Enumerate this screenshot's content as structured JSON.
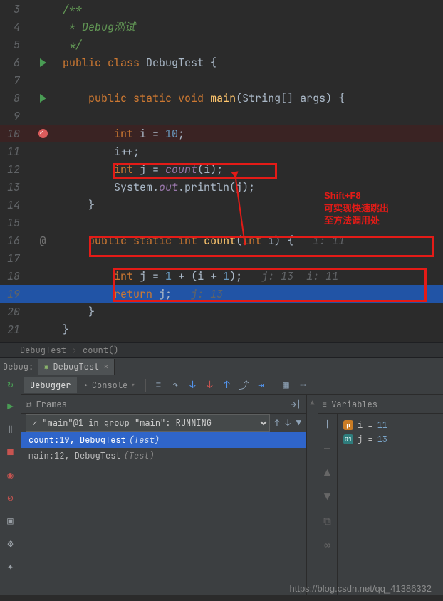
{
  "code": {
    "lines": [
      {
        "n": "3",
        "html": "/**",
        "cls": "doc"
      },
      {
        "n": "4",
        "html": " * Debug测试",
        "cls": "doc"
      },
      {
        "n": "5",
        "html": " */",
        "cls": "doc"
      },
      {
        "n": "6",
        "run": true,
        "tokens": [
          [
            "kw",
            "public "
          ],
          [
            "kw",
            "class "
          ],
          [
            "cls",
            "DebugTest "
          ],
          [
            "id",
            "{"
          ]
        ]
      },
      {
        "n": "7"
      },
      {
        "n": "8",
        "run": true,
        "indent": "    ",
        "tokens": [
          [
            "kw",
            "public "
          ],
          [
            "kw",
            "static "
          ],
          [
            "kw",
            "void "
          ],
          [
            "mth",
            "main"
          ],
          [
            "id",
            "(String[] args) {"
          ]
        ]
      },
      {
        "n": "9"
      },
      {
        "n": "10",
        "bp": true,
        "indent": "        ",
        "tokens": [
          [
            "kw",
            "int "
          ],
          [
            "id",
            "i = "
          ],
          [
            "num",
            "10"
          ],
          [
            "id",
            ";"
          ]
        ],
        "lineCls": "line-bp"
      },
      {
        "n": "11",
        "indent": "        ",
        "tokens": [
          [
            "id",
            "i++;"
          ]
        ]
      },
      {
        "n": "12",
        "indent": "        ",
        "tokens": [
          [
            "kw",
            "int "
          ],
          [
            "id",
            "j = "
          ],
          [
            "fld",
            "count"
          ],
          [
            "id",
            "(i);"
          ]
        ]
      },
      {
        "n": "13",
        "indent": "        ",
        "tokens": [
          [
            "id",
            "System."
          ],
          [
            "fld",
            "out"
          ],
          [
            "id",
            ".println(j);"
          ]
        ]
      },
      {
        "n": "14",
        "indent": "    ",
        "tokens": [
          [
            "id",
            "}"
          ]
        ]
      },
      {
        "n": "15"
      },
      {
        "n": "16",
        "at": true,
        "indent": "    ",
        "tokens": [
          [
            "kw",
            "public "
          ],
          [
            "kw",
            "static "
          ],
          [
            "kw",
            "int "
          ],
          [
            "mth",
            "count"
          ],
          [
            "id",
            "("
          ],
          [
            "kw",
            "int "
          ],
          [
            "id",
            "i) {   "
          ],
          [
            "hint",
            "i: 11"
          ]
        ]
      },
      {
        "n": "17"
      },
      {
        "n": "18",
        "indent": "        ",
        "tokens": [
          [
            "kw",
            "int "
          ],
          [
            "id",
            "j = "
          ],
          [
            "num",
            "1"
          ],
          [
            "id",
            " + (i + "
          ],
          [
            "num",
            "1"
          ],
          [
            "id",
            ");   "
          ],
          [
            "hint",
            "j: 13  i: 11"
          ]
        ]
      },
      {
        "n": "19",
        "lineCls": "line-current",
        "indent": "        ",
        "tokens": [
          [
            "kw",
            "return "
          ],
          [
            "id",
            "j;   "
          ],
          [
            "hint",
            "j: 13"
          ]
        ]
      },
      {
        "n": "20",
        "indent": "    ",
        "tokens": [
          [
            "id",
            "}"
          ]
        ]
      },
      {
        "n": "21",
        "indent": "",
        "tokens": [
          [
            "id",
            "}"
          ]
        ]
      }
    ]
  },
  "annotation": {
    "shortcut": "Shift+F8",
    "line2": "可实现快速跳出",
    "line3": "至方法调用处"
  },
  "breadcrumb": {
    "cls": "DebugTest",
    "mth": "count()"
  },
  "debug": {
    "label": "Debug:",
    "tab": "DebugTest",
    "tabs": {
      "debugger": "Debugger",
      "console": "Console"
    },
    "frames": {
      "title": "Frames",
      "thread": "✓ \"main\"@1 in group \"main\": RUNNING",
      "items": [
        {
          "main": "count:19, DebugTest",
          "gray": "(Test)",
          "sel": true
        },
        {
          "main": "main:12, DebugTest",
          "gray": "(Test)",
          "sel": false
        }
      ]
    },
    "vars": {
      "title": "Variables",
      "items": [
        {
          "badge": "p",
          "bcls": "badge-p",
          "name": "i",
          "val": "11"
        },
        {
          "badge": "01",
          "bcls": "badge-o",
          "name": "j",
          "val": "13"
        }
      ]
    }
  },
  "watermark": "https://blog.csdn.net/qq_41386332",
  "chart_data": null
}
